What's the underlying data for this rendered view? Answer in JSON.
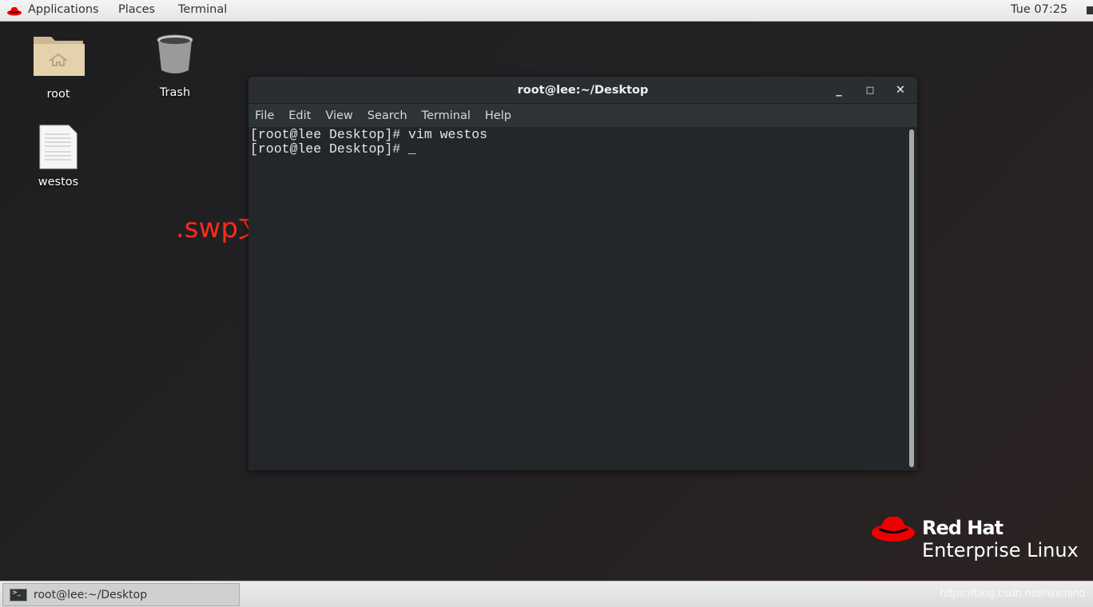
{
  "topbar": {
    "menus": [
      "Applications",
      "Places",
      "Terminal"
    ],
    "clock": "Tue 07:25"
  },
  "desktop": {
    "icons": [
      {
        "label": "root",
        "icon": "home-folder-icon"
      },
      {
        "label": "Trash",
        "icon": "trash-icon"
      },
      {
        "label": "westos",
        "icon": "text-file-icon"
      }
    ]
  },
  "terminal": {
    "title": "root@lee:~/Desktop",
    "menu": [
      "File",
      "Edit",
      "View",
      "Search",
      "Terminal",
      "Help"
    ],
    "lines": [
      "[root@lee Desktop]# vim westos",
      "[root@lee Desktop]# _"
    ]
  },
  "annotation": ".swp文件消失",
  "logo": {
    "line1": "Red Hat",
    "line2": "Enterprise Linux"
  },
  "taskbar": {
    "item": "root@lee:~/Desktop"
  },
  "watermark": "https://blog.csdn.net/ninimino",
  "colors": {
    "accent": "#ee0000",
    "annotation": "#ff2a1a"
  }
}
